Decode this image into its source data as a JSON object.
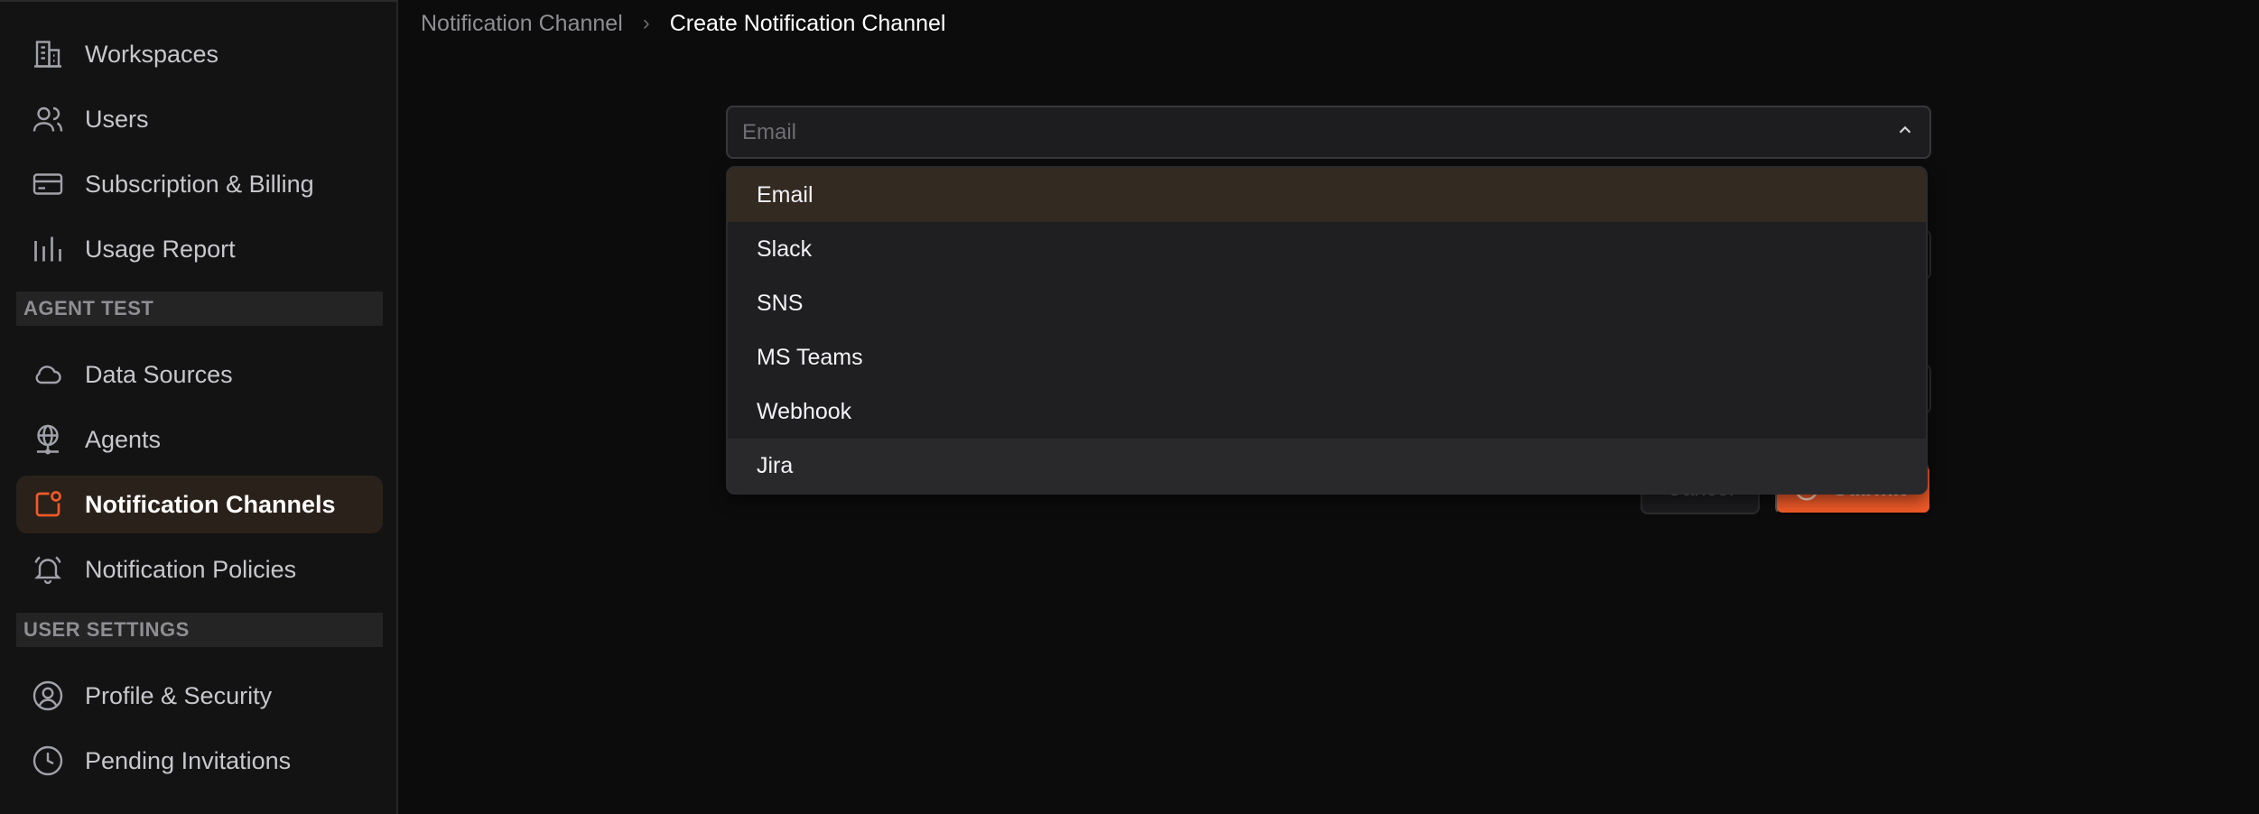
{
  "sidebar": {
    "items": [
      {
        "label": "Workspaces",
        "icon": "building-icon"
      },
      {
        "label": "Users",
        "icon": "users-icon"
      },
      {
        "label": "Subscription & Billing",
        "icon": "credit-card-icon"
      },
      {
        "label": "Usage Report",
        "icon": "bar-chart-icon"
      }
    ],
    "section_agent": "AGENT TEST",
    "agent_items": [
      {
        "label": "Data Sources",
        "icon": "cloud-icon"
      },
      {
        "label": "Agents",
        "icon": "globe-icon"
      },
      {
        "label": "Notification Channels",
        "icon": "notification-channel-icon"
      },
      {
        "label": "Notification Policies",
        "icon": "bell-icon"
      }
    ],
    "section_user": "USER SETTINGS",
    "user_items": [
      {
        "label": "Profile & Security",
        "icon": "user-circle-icon"
      },
      {
        "label": "Pending Invitations",
        "icon": "clock-icon"
      }
    ]
  },
  "breadcrumb": {
    "parent": "Notification Channel",
    "current": "Create Notification Channel"
  },
  "form": {
    "channel_type_placeholder": "Email",
    "cancel_label": "Cancel",
    "submit_label": "Submit"
  },
  "dropdown": {
    "options": [
      "Email",
      "Slack",
      "SNS",
      "MS Teams",
      "Webhook",
      "Jira"
    ],
    "selected": "Email",
    "hovered": "Jira"
  },
  "colors": {
    "accent": "#f05a28",
    "active_nav_bg": "#2a211a",
    "selected_option_bg": "#332a21"
  }
}
